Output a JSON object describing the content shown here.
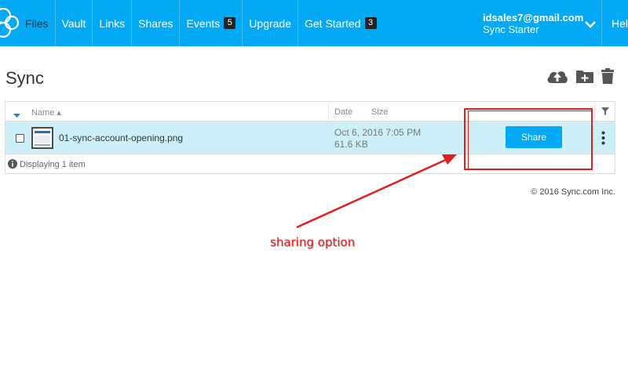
{
  "nav": {
    "items": [
      {
        "label": "Files",
        "active": true
      },
      {
        "label": "Vault"
      },
      {
        "label": "Links"
      },
      {
        "label": "Shares"
      },
      {
        "label": "Events",
        "badge": "5"
      },
      {
        "label": "Upgrade"
      },
      {
        "label": "Get Started",
        "badge": "3"
      }
    ],
    "user_email": "idsales7@gmail.com",
    "user_plan": "Sync Starter",
    "help_label": "Help"
  },
  "page": {
    "title": "Sync"
  },
  "table": {
    "columns": {
      "name": "Name",
      "date": "Date",
      "size": "Size"
    },
    "rows": [
      {
        "filename": "01-sync-account-opening.png",
        "date": "Oct 6, 2016 7:05 PM",
        "size": "61.6 KB",
        "action_label": "Share"
      }
    ],
    "footer": "Displaying 1 item"
  },
  "footer": {
    "copyright": "© 2016 Sync.com Inc."
  },
  "annotation": {
    "label": "sharing option"
  },
  "colors": {
    "brand": "#03a9f4",
    "row_highlight": "#cdeffa",
    "annotation": "#e02020"
  },
  "icons": [
    "sync-logo-icon",
    "chevron-down-icon",
    "upload-cloud-icon",
    "new-folder-icon",
    "trash-icon",
    "sort-caret-icon",
    "filter-icon",
    "more-vertical-icon",
    "info-icon"
  ]
}
